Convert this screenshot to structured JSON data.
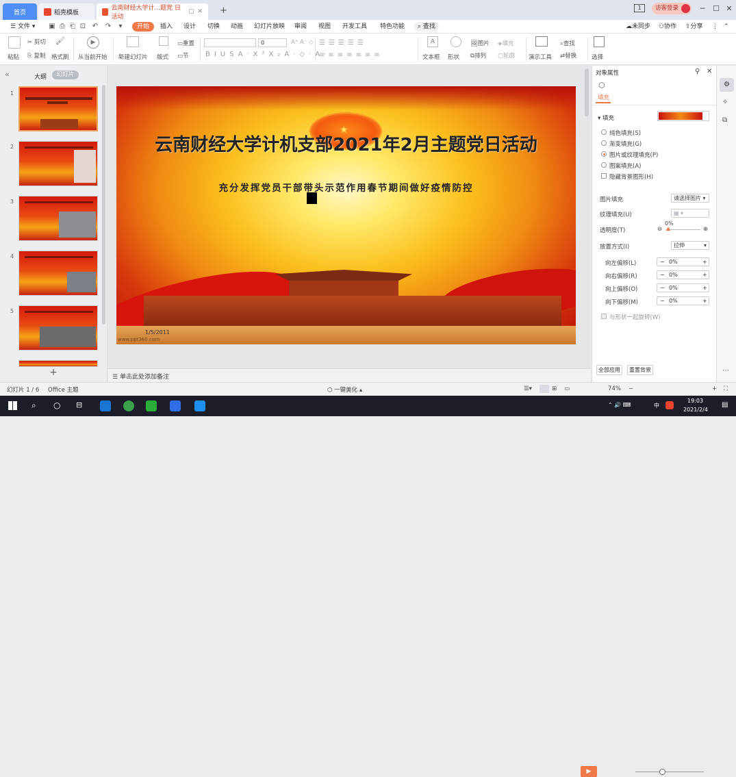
{
  "tabs": {
    "home": "首页",
    "templates": "稻壳模板",
    "document": "云南财经大学计...题党 日活动",
    "new_tab": "+"
  },
  "window": {
    "tab_count": "1",
    "login": "访客登录",
    "min": "─",
    "max": "☐",
    "close": "✕"
  },
  "menubar": {
    "file": "文件",
    "items": [
      "开始",
      "插入",
      "设计",
      "切换",
      "动画",
      "幻灯片放映",
      "审阅",
      "视图",
      "开发工具",
      "特色功能"
    ],
    "search": "查找",
    "unsync": "未同步",
    "collab": "协作",
    "share": "分享"
  },
  "ribbon": {
    "paste": "粘贴",
    "cut": "剪切",
    "copy": "复制",
    "format_painter": "格式刷",
    "play_from_current": "从当前开始",
    "new_slide": "新建幻灯片",
    "layout": "版式",
    "section": "节",
    "reset": "重置",
    "font_size": "0",
    "text_box": "文本框",
    "shape": "形状",
    "arrange": "排列",
    "picture": "图片",
    "fill": "填充",
    "outline": "轮廓",
    "presenter_tools": "演示工具",
    "find": "查找",
    "replace": "替换",
    "select": "选择"
  },
  "leftpanel": {
    "outline": "大纲",
    "slides": "幻灯片",
    "numbers": [
      "1",
      "2",
      "3",
      "4",
      "5"
    ]
  },
  "slide": {
    "title": "云南财经大学计机支部2021年2月主题党日活动",
    "subtitle": "充分发挥党员干部带头示范作用春节期间做好疫情防控",
    "date": "1/5/2011",
    "watermark": "www.ppt360.com"
  },
  "notes": {
    "placeholder": "单击此处添加备注"
  },
  "properties": {
    "title": "对象属性",
    "tab": "填充",
    "fill_label": "填充",
    "options": [
      "纯色填充(S)",
      "渐变填充(G)",
      "图片或纹理填充(P)",
      "图案填充(A)"
    ],
    "selected_option": 2,
    "hide_bg": "隐藏背景图形(H)",
    "picture_fill": "图片填充",
    "picture_fill_value": "请选择图片",
    "texture_fill": "纹理填充(U)",
    "transparency": "透明度(T)",
    "transparency_value": "0%",
    "placement": "放置方式(I)",
    "placement_value": "拉伸",
    "offsets": [
      {
        "label": "向左偏移(L)",
        "value": "0%"
      },
      {
        "label": "向右偏移(R)",
        "value": "0%"
      },
      {
        "label": "向上偏移(O)",
        "value": "0%"
      },
      {
        "label": "向下偏移(M)",
        "value": "0%"
      }
    ],
    "rotate_with_shape": "与形状一起旋转(W)",
    "apply_all": "全部应用",
    "reset_bg": "重置背景"
  },
  "statusbar": {
    "slide_info": "幻灯片 1 / 6",
    "theme": "Office 主题",
    "beautify": "一键美化",
    "zoom": "74%"
  },
  "taskbar": {
    "time": "19:03",
    "date": "2021/2/4",
    "ime": "中"
  },
  "colors": {
    "accent": "#f07848",
    "home_tab": "#4f8ef7",
    "doc_tab_text": "#d24726"
  }
}
